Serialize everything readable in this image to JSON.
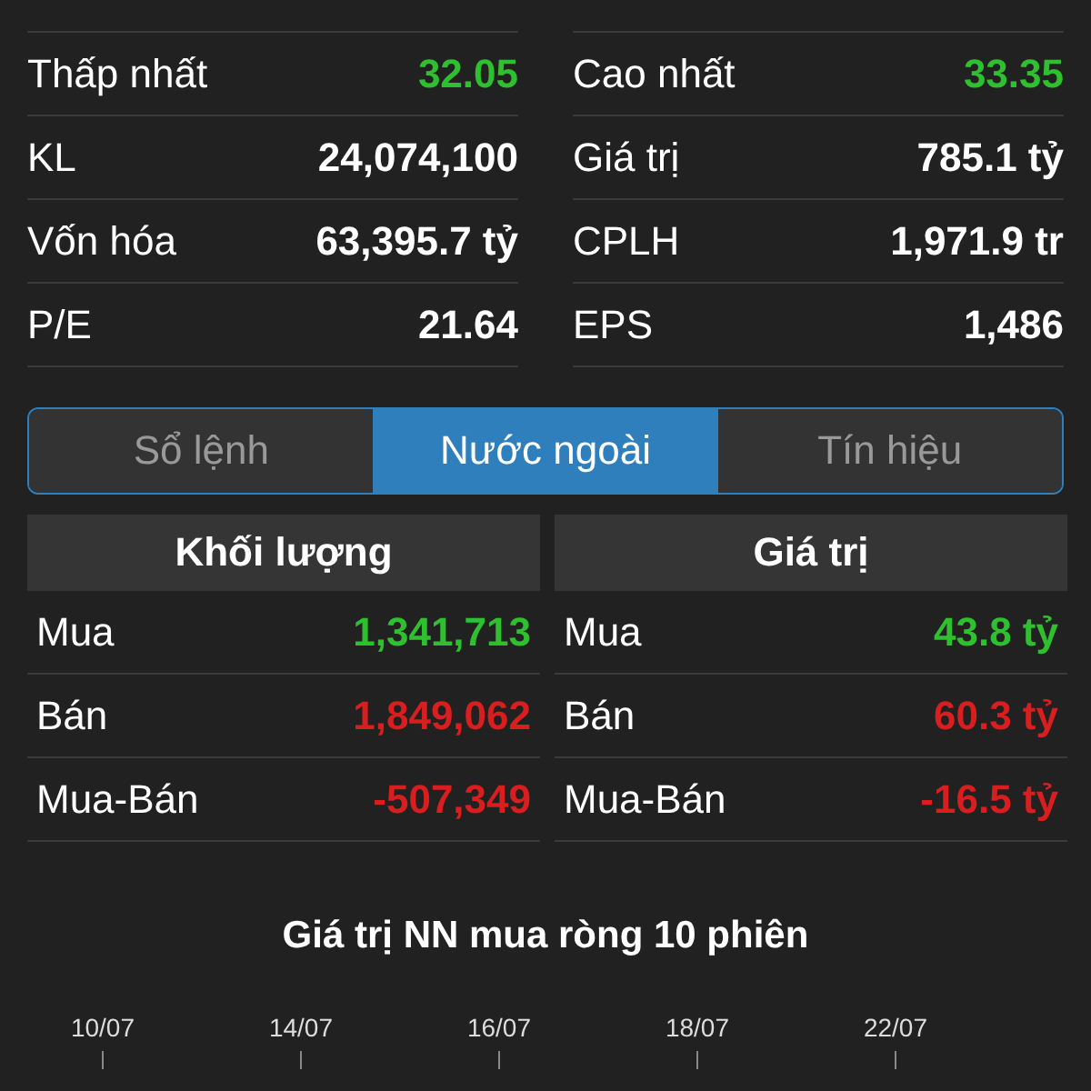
{
  "stats": [
    {
      "label": "Thấp nhất",
      "value": "32.05",
      "color": "#2fc02f"
    },
    {
      "label": "Cao nhất",
      "value": "33.35",
      "color": "#2fc02f"
    },
    {
      "label": "KL",
      "value": "24,074,100",
      "color": "#ffffff"
    },
    {
      "label": "Giá trị",
      "value": "785.1 tỷ",
      "color": "#ffffff"
    },
    {
      "label": "Vốn hóa",
      "value": "63,395.7 tỷ",
      "color": "#ffffff"
    },
    {
      "label": "CPLH",
      "value": "1,971.9 tr",
      "color": "#ffffff"
    },
    {
      "label": "P/E",
      "value": "21.64",
      "color": "#ffffff"
    },
    {
      "label": "EPS",
      "value": "1,486",
      "color": "#ffffff"
    }
  ],
  "tabs": [
    {
      "label": "Sổ lệnh",
      "selected": false
    },
    {
      "label": "Nước ngoài",
      "selected": true
    },
    {
      "label": "Tín hiệu",
      "selected": false
    }
  ],
  "foreign": [
    {
      "title": "Khối lượng",
      "rows": [
        {
          "label": "Mua",
          "value": "1,341,713",
          "color": "#2fc02f"
        },
        {
          "label": "Bán",
          "value": "1,849,062",
          "color": "#d81e1e"
        },
        {
          "label": "Mua-Bán",
          "value": "-507,349",
          "color": "#d81e1e"
        }
      ]
    },
    {
      "title": "Giá trị",
      "rows": [
        {
          "label": "Mua",
          "value": "43.8 tỷ",
          "color": "#2fc02f"
        },
        {
          "label": "Bán",
          "value": "60.3 tỷ",
          "color": "#d81e1e"
        },
        {
          "label": "Mua-Bán",
          "value": "-16.5 tỷ",
          "color": "#d81e1e"
        }
      ]
    }
  ],
  "chart": {
    "title": "Giá trị NN mua ròng 10 phiên",
    "dates": [
      "10/07",
      "14/07",
      "16/07",
      "18/07",
      "22/07"
    ]
  }
}
